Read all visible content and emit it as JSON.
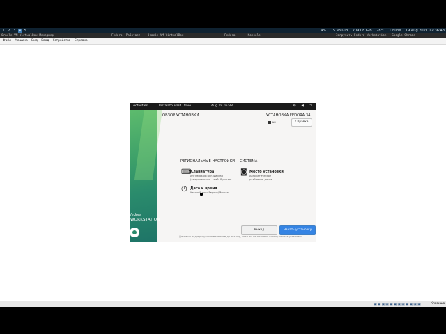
{
  "topbar": {
    "workspaces": [
      "1",
      "2",
      "3",
      "4",
      "5"
    ],
    "active_ws": "4",
    "stats": [
      "4%",
      "15.98 GiB",
      "709.08 GiB",
      "28°C",
      "Online",
      "19 Aug 2021 12:36:48"
    ]
  },
  "window_titles": {
    "t1": "Oracle VM VirtualBox Менеджер",
    "t2": "Fedora [Работает] - Oracle VM VirtualBox",
    "t3": "Fedora : ~ - Konsole",
    "t4": "Загрузить Fedora Workstation - Google Chrome"
  },
  "menubar": [
    "Файл",
    "Машина",
    "Вид",
    "Ввод",
    "Устройства",
    "Справка"
  ],
  "guest_topbar": {
    "activities": "Activities",
    "app": "Install to Hard Drive",
    "clock": "Aug 19  05:38",
    "sys_icons": "⚙ ◀ ⏻"
  },
  "sidebar": {
    "fedora": "fedora",
    "workstation": "WORKSTATION"
  },
  "main": {
    "overview_title": "ОБЗОР УСТАНОВКИ",
    "install_title": "УСТАНОВКА FEDORA 34",
    "lang": "us",
    "help": "Справка",
    "section_regional": "РЕГИОНАЛЬНЫЕ НАСТРОЙКИ",
    "section_system": "СИСТЕМА",
    "keyboard_title": "Клавиатура",
    "keyboard_sub1": "Английская (Английская",
    "keyboard_sub2": "(американская...ский (Русская)",
    "datetime_title": "Дата и время",
    "datetime_sub": "Часовой пояс Европа/Москва",
    "dest_title": "Место установки",
    "dest_sub1": "Автоматическое",
    "dest_sub2": "разбиение диска",
    "quit": "Выход",
    "begin": "Начать установку",
    "warning": "Диски не подвергнутся изменениям до тех пор, пока вы не нажмете кнопку начала установки"
  },
  "statusbar": {
    "hostkey": "Клавиша Meta"
  },
  "colors": {
    "accent": "#3584e4",
    "fedora_green": "#3c9f69",
    "topbar_bg": "#0f2231"
  }
}
